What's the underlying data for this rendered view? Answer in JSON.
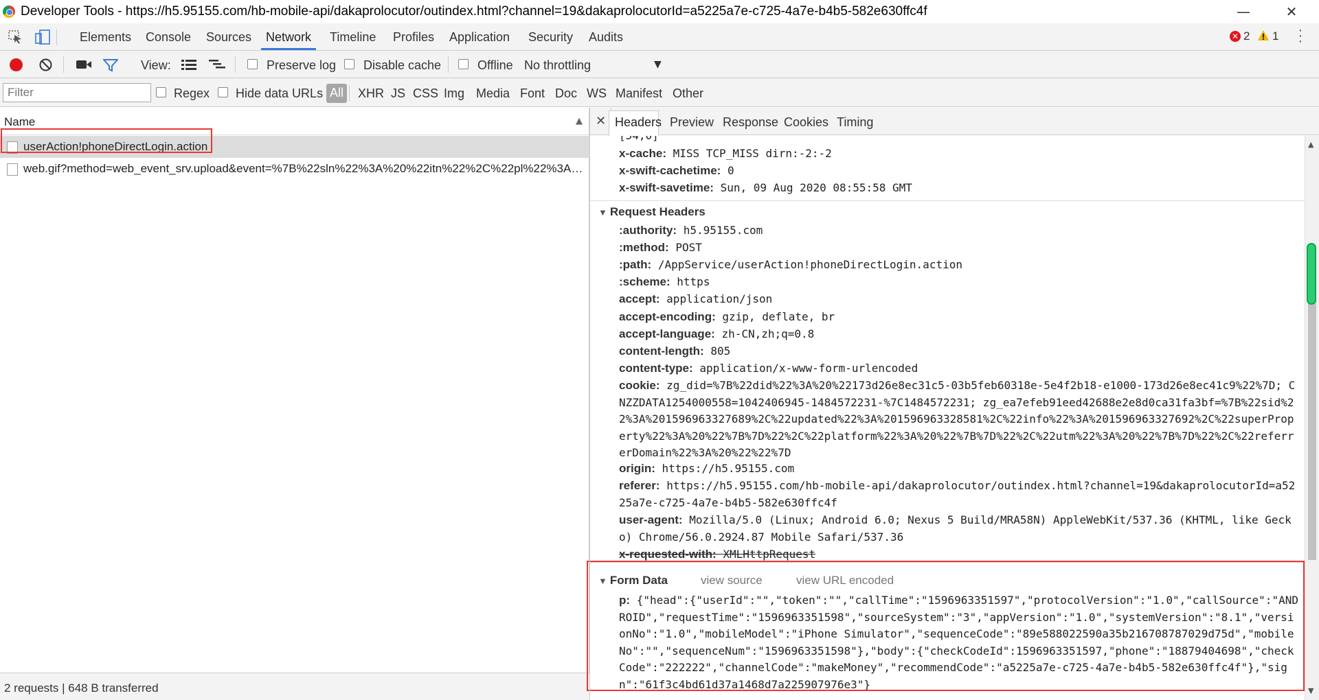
{
  "window": {
    "title": "Developer Tools - https://h5.95155.com/hb-mobile-api/dakaprolocutor/outindex.html?channel=19&dakaprolocutorId=a5225a7e-c725-4a7e-b4b5-582e630ffc4f",
    "minimize": "—",
    "restore": "❐",
    "close": "✕"
  },
  "main_tabs": [
    "Elements",
    "Console",
    "Sources",
    "Network",
    "Timeline",
    "Profiles",
    "Application",
    "Security",
    "Audits"
  ],
  "active_tab": "Network",
  "counters": {
    "errors": "2",
    "warnings": "1"
  },
  "toolbar": {
    "view_label": "View:",
    "preserve_log": "Preserve log",
    "disable_cache": "Disable cache",
    "offline": "Offline",
    "throttling": "No throttling"
  },
  "filterbar": {
    "placeholder": "Filter",
    "regex": "Regex",
    "hide_data_urls": "Hide data URLs",
    "types": [
      "All",
      "XHR",
      "JS",
      "CSS",
      "Img",
      "Media",
      "Font",
      "Doc",
      "WS",
      "Manifest",
      "Other"
    ]
  },
  "requests_pane": {
    "header": "Name",
    "rows": [
      "userAction!phoneDirectLogin.action",
      "web.gif?method=web_event_srv.upload&event=%7B%22sln%22%3A%20%22itn%22%2C%22pl%22%3A%20%2..."
    ],
    "status": "2 requests  |  648 B transferred"
  },
  "detail_tabs": [
    "Headers",
    "Preview",
    "Response",
    "Cookies",
    "Timing"
  ],
  "active_detail_tab": "Headers",
  "response_headers_tail": [
    {
      "k": "",
      "v": "[54,0]"
    },
    {
      "k": "x-cache:",
      "v": "MISS TCP_MISS dirn:-2:-2"
    },
    {
      "k": "x-swift-cachetime:",
      "v": "0"
    },
    {
      "k": "x-swift-savetime:",
      "v": "Sun, 09 Aug 2020 08:55:58 GMT"
    }
  ],
  "request_headers": {
    "title": "Request Headers",
    "items": [
      {
        "k": ":authority:",
        "v": "h5.95155.com"
      },
      {
        "k": ":method:",
        "v": "POST"
      },
      {
        "k": ":path:",
        "v": "/AppService/userAction!phoneDirectLogin.action"
      },
      {
        "k": ":scheme:",
        "v": "https"
      },
      {
        "k": "accept:",
        "v": "application/json"
      },
      {
        "k": "accept-encoding:",
        "v": "gzip, deflate, br"
      },
      {
        "k": "accept-language:",
        "v": "zh-CN,zh;q=0.8"
      },
      {
        "k": "content-length:",
        "v": "805"
      },
      {
        "k": "content-type:",
        "v": "application/x-www-form-urlencoded"
      }
    ],
    "cookie_key": "cookie:",
    "cookie_value": "zg_did=%7B%22did%22%3A%20%22173d26e8ec31c5-03b5feb60318e-5e4f2b18-e1000-173d26e8ec41c9%22%7D; CNZZDATA1254000558=1042406945-1484572231-%7C1484572231; zg_ea7efeb91eed42688e2e8d0ca31fa3bf=%7B%22sid%22%3A%201596963327689%2C%22updated%22%3A%201596963328581%2C%22info%22%3A%201596963327692%2C%22superProperty%22%3A%20%22%7B%7D%22%2C%22platform%22%3A%20%22%7B%7D%22%2C%22utm%22%3A%20%22%7B%7D%22%2C%22referrerDomain%22%3A%20%22%22%7D",
    "origin_key": "origin:",
    "origin_value": "https://h5.95155.com",
    "referer_key": "referer:",
    "referer_value": "https://h5.95155.com/hb-mobile-api/dakaprolocutor/outindex.html?channel=19&dakaprolocutorId=a5225a7e-c725-4a7e-b4b5-582e630ffc4f",
    "ua_key": "user-agent:",
    "ua_value": "Mozilla/5.0 (Linux; Android 6.0; Nexus 5 Build/MRA58N) AppleWebKit/537.36 (KHTML, like Gecko) Chrome/56.0.2924.87 Mobile Safari/537.36",
    "xrw_key": "x-requested-with:",
    "xrw_value": "XMLHttpRequest"
  },
  "form_data": {
    "title": "Form Data",
    "view_source": "view source",
    "view_url_encoded": "view URL encoded",
    "p_key": "p:",
    "p_value": "{\"head\":{\"userId\":\"\",\"token\":\"\",\"callTime\":\"1596963351597\",\"protocolVersion\":\"1.0\",\"callSource\":\"ANDROID\",\"requestTime\":\"1596963351598\",\"sourceSystem\":\"3\",\"appVersion\":\"1.0\",\"systemVersion\":\"8.1\",\"versionNo\":\"1.0\",\"mobileModel\":\"iPhone Simulator\",\"sequenceCode\":\"89e588022590a35b216708787029d75d\",\"mobileNo\":\"\",\"sequenceNum\":\"1596963351598\"},\"body\":{\"checkCodeId\":1596963351597,\"phone\":\"18879404698\",\"checkCode\":\"222222\",\"channelCode\":\"makeMoney\",\"recommendCode\":\"a5225a7e-c725-4a7e-b4b5-582e630ffc4f\"},\"sign\":\"61f3c4bd61d37a1468d7a225907976e3\"}"
  },
  "colors": {
    "accent": "#3879d9",
    "highlight": "#e53935",
    "record": "#e0151b"
  }
}
